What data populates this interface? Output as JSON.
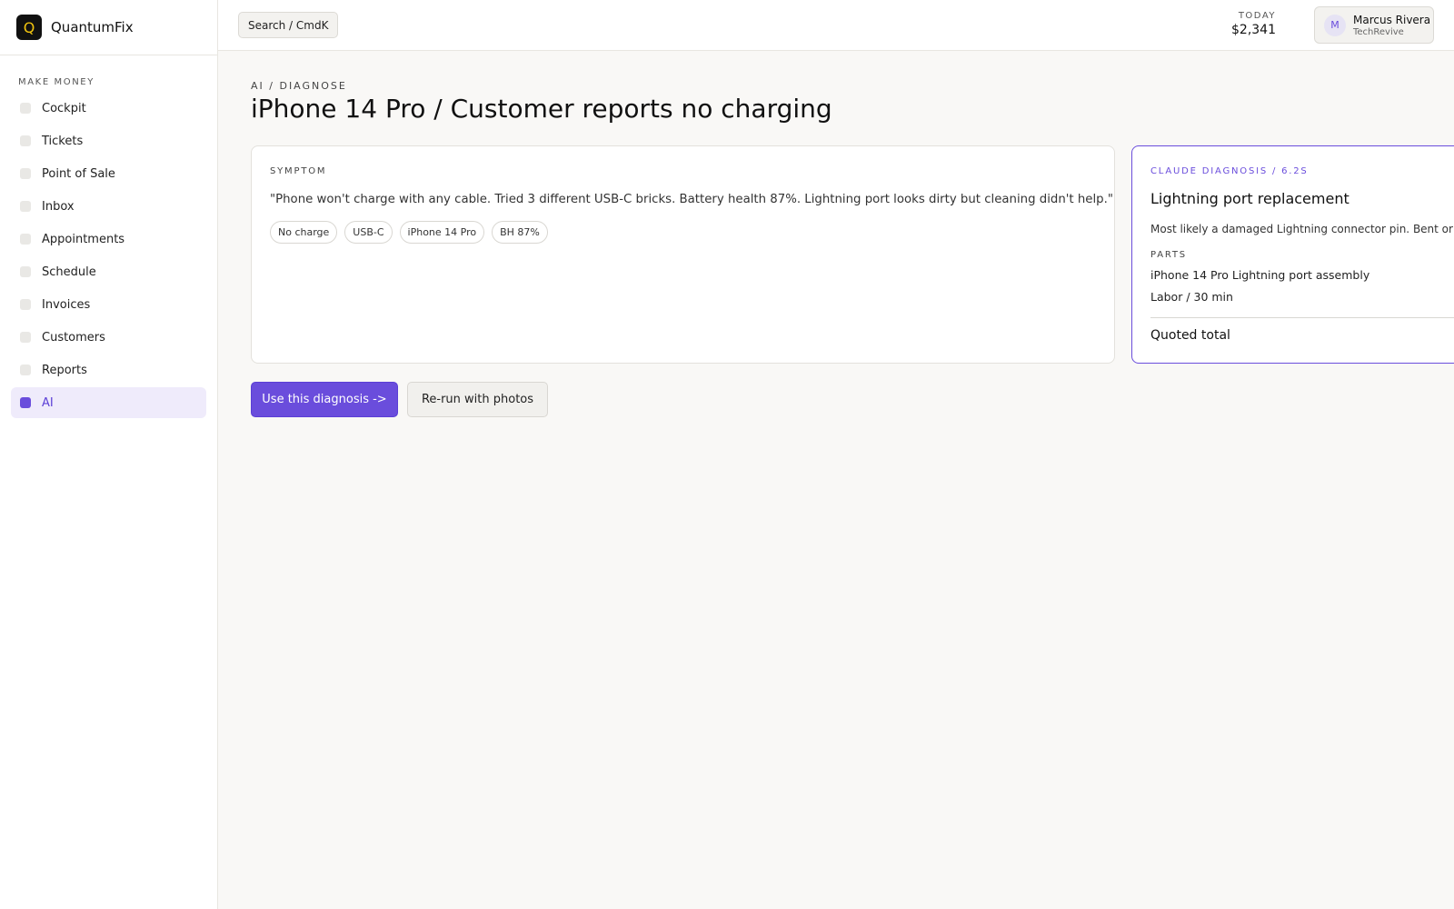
{
  "brand": {
    "logo_letter": "Q",
    "name": "QuantumFix"
  },
  "sidebar": {
    "section_label": "MAKE MONEY",
    "items": [
      {
        "label": "Cockpit",
        "active": false
      },
      {
        "label": "Tickets",
        "active": false
      },
      {
        "label": "Point of Sale",
        "active": false
      },
      {
        "label": "Inbox",
        "active": false
      },
      {
        "label": "Appointments",
        "active": false
      },
      {
        "label": "Schedule",
        "active": false
      },
      {
        "label": "Invoices",
        "active": false
      },
      {
        "label": "Customers",
        "active": false
      },
      {
        "label": "Reports",
        "active": false
      },
      {
        "label": "AI",
        "active": true
      }
    ]
  },
  "topbar": {
    "search_label": "Search / CmdK",
    "today_label": "TODAY",
    "today_value": "$2,341",
    "user": {
      "avatar_letter": "M",
      "name": "Marcus Rivera",
      "org": "TechRevive"
    }
  },
  "page": {
    "breadcrumb": "AI / DIAGNOSE",
    "title": "iPhone 14 Pro / Customer reports no charging"
  },
  "symptom": {
    "label": "SYMPTOM",
    "quote": "\"Phone won't charge with any cable. Tried 3 different USB-C bricks. Battery health 87%. Lightning port looks dirty but cleaning didn't help.\"",
    "chips": [
      "No charge",
      "USB-C",
      "iPhone 14 Pro",
      "BH 87%"
    ]
  },
  "diagnosis": {
    "label": "CLAUDE DIAGNOSIS / 6.2S",
    "title": "Lightning port replacement",
    "description": "Most likely a damaged Lightning connector pin. Bent or c",
    "parts_label": "PARTS",
    "parts": [
      "iPhone 14 Pro Lightning port assembly",
      "Labor / 30 min"
    ],
    "total_label": "Quoted total"
  },
  "actions": {
    "primary": "Use this diagnosis ->",
    "secondary": "Re-run with photos"
  },
  "colors": {
    "accent": "#6a4ddc",
    "brand_logo_bg": "#111111",
    "brand_logo_fg": "#f1c40f",
    "active_nav_bg": "#efebfb"
  }
}
